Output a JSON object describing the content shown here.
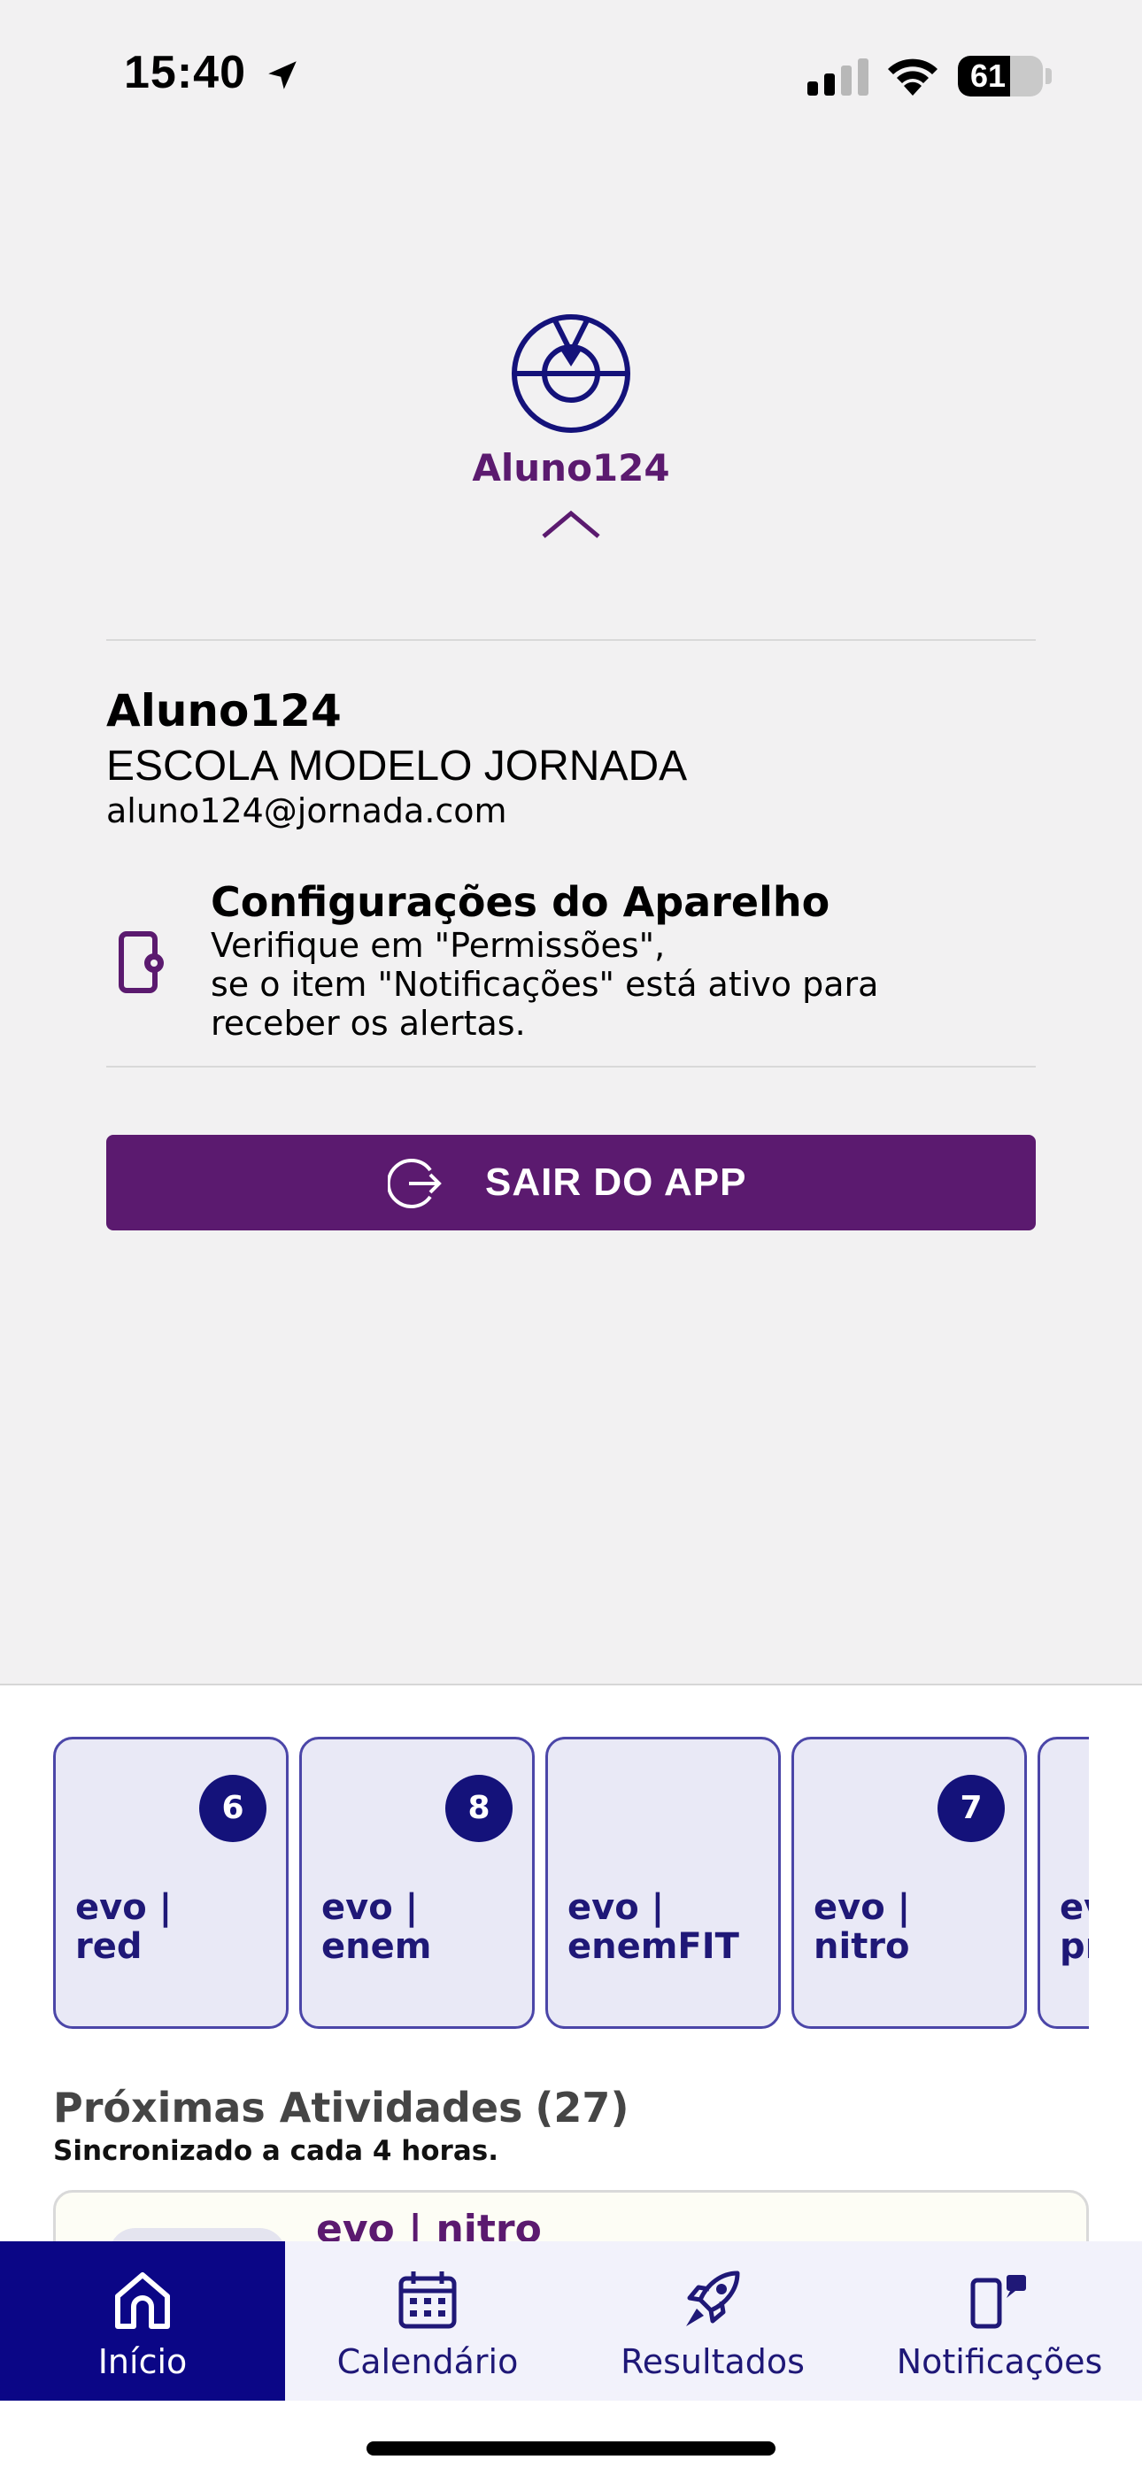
{
  "status_bar": {
    "time": "15:40",
    "battery": "61",
    "battery_level": 0.61
  },
  "profile": {
    "header_name": "Aluno124",
    "name": "Aluno124",
    "school": "ESCOLA MODELO JORNADA",
    "email": "aluno124@jornada.com"
  },
  "settings": {
    "title": "Configurações do Aparelho",
    "description": "Verifique em \"Permissões\",\nse o item \"Notificações\" está ativo para\nreceber os alertas."
  },
  "logout": {
    "label": "SAIR DO APP"
  },
  "courses": [
    {
      "name": "evo |\nred",
      "badge": "6"
    },
    {
      "name": "evo |\nenem",
      "badge": "8"
    },
    {
      "name": "evo |\nenemFIT",
      "badge": ""
    },
    {
      "name": "evo |\nnitro",
      "badge": "7"
    },
    {
      "name": "evo |\npro",
      "badge": ""
    }
  ],
  "activities": {
    "title": "Próximas Atividades",
    "count": "(27)",
    "subtitle": "Sincronizado a cada 4 horas.",
    "first_item_title": "evo | nitro"
  },
  "tabs": [
    {
      "label": "Início",
      "icon": "home-icon",
      "active": true
    },
    {
      "label": "Calendário",
      "icon": "calendar-icon",
      "active": false
    },
    {
      "label": "Resultados",
      "icon": "rocket-icon",
      "active": false
    },
    {
      "label": "Notificações",
      "icon": "notifications-icon",
      "active": false
    }
  ],
  "colors": {
    "brand_purple": "#5b1a6f",
    "navy": "#0b0686",
    "card_border": "#4b46a8",
    "background": "#f2f1f2"
  }
}
